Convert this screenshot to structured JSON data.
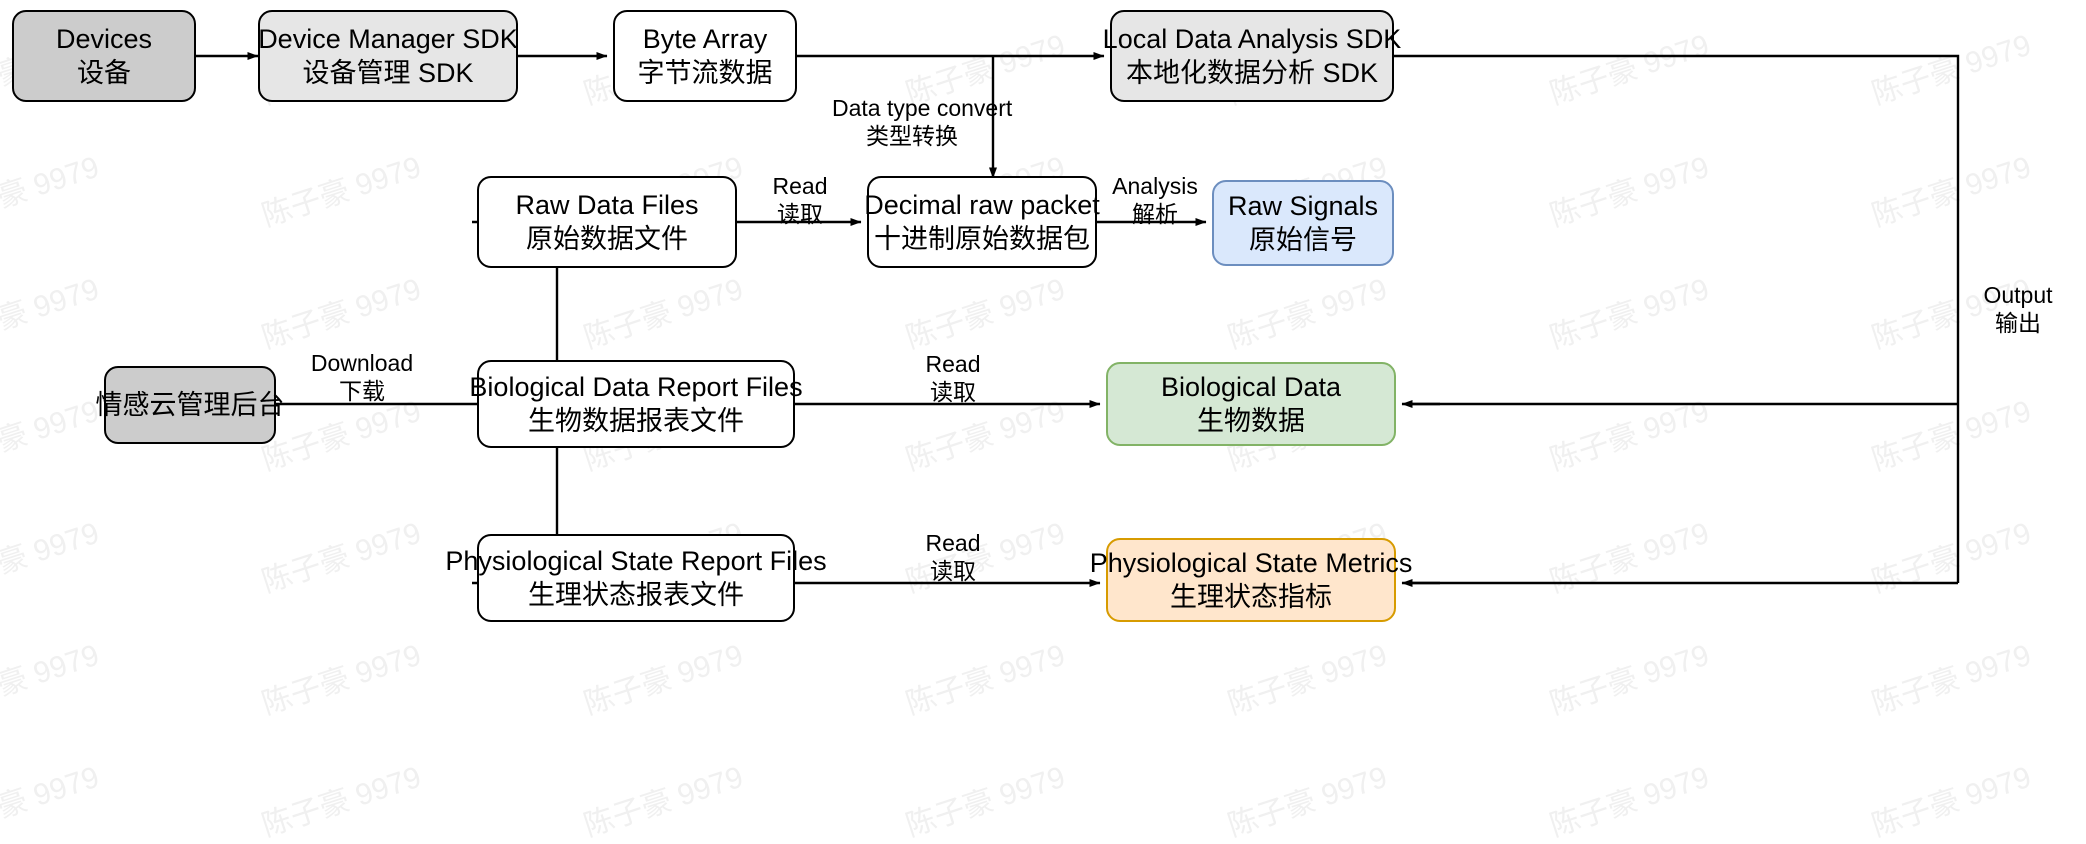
{
  "diagram": {
    "title": "Device data acquisition and analysis flow",
    "watermark": "陈子豪 9979",
    "colors": {
      "canvas_background": "#ffffff",
      "stroke": "#000000",
      "node_gray_dark_fill": "#cccccc",
      "node_gray_light_fill": "#e6e6e6",
      "node_white_fill": "#ffffff",
      "node_blue_fill": "#dae8fc",
      "node_blue_stroke": "#6c8ebf",
      "node_green_fill": "#d5e8d4",
      "node_green_stroke": "#82b366",
      "node_yellow_fill": "#ffe6cc",
      "node_yellow_stroke": "#d79b00",
      "watermark_color": "#f0f0f0"
    },
    "nodes": [
      {
        "id": "devices",
        "en": "Devices",
        "zh": "设备"
      },
      {
        "id": "device-manager-sdk",
        "en": "Device Manager SDK",
        "zh": "设备管理 SDK"
      },
      {
        "id": "byte-array",
        "en": "Byte Array",
        "zh": "字节流数据"
      },
      {
        "id": "local-analysis-sdk",
        "en": "Local Data Analysis SDK",
        "zh": "本地化数据分析 SDK"
      },
      {
        "id": "raw-data-files",
        "en": "Raw Data Files",
        "zh": "原始数据文件"
      },
      {
        "id": "decimal-raw-packet",
        "en": "Decimal raw packet",
        "zh": "十进制原始数据包"
      },
      {
        "id": "raw-signals",
        "en": "Raw Signals",
        "zh": "原始信号"
      },
      {
        "id": "cloud-backend",
        "en": "",
        "zh": "情感云管理后台"
      },
      {
        "id": "bio-report-files",
        "en": "Biological Data Report Files",
        "zh": "生物数据报表文件"
      },
      {
        "id": "biological-data",
        "en": "Biological Data",
        "zh": "生物数据"
      },
      {
        "id": "physio-report-files",
        "en": "Physiological State Report Files",
        "zh": "生理状态报表文件"
      },
      {
        "id": "physio-metrics",
        "en": "Physiological State Metrics",
        "zh": "生理状态指标"
      }
    ],
    "edge_labels": [
      {
        "id": "data-type-convert",
        "en": "Data type convert",
        "zh": "类型转换"
      },
      {
        "id": "read-raw",
        "en": "Read",
        "zh": "读取"
      },
      {
        "id": "analysis",
        "en": "Analysis",
        "zh": "解析"
      },
      {
        "id": "download",
        "en": "Download",
        "zh": "下载"
      },
      {
        "id": "read-bio",
        "en": "Read",
        "zh": "读取"
      },
      {
        "id": "read-physio",
        "en": "Read",
        "zh": "读取"
      },
      {
        "id": "output",
        "en": "Output",
        "zh": "输出"
      }
    ]
  }
}
